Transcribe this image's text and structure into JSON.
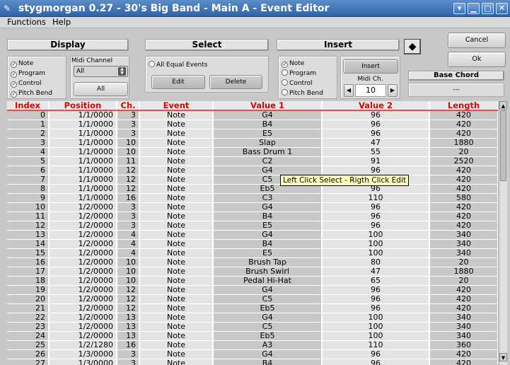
{
  "window": {
    "title": "stygmorgan 0.27 - 30's Big Band - Main A - Event Editor",
    "controls": [
      "▾",
      "▁",
      "□",
      "✕"
    ]
  },
  "menu": [
    "Functions",
    "Help"
  ],
  "display": {
    "header": "Display",
    "options": [
      "Note",
      "Program",
      "Control",
      "Pitch Bend"
    ],
    "midi_channel_label": "Midi Channel",
    "midi_channel_value": "All",
    "all_button": "All"
  },
  "select": {
    "header": "Select",
    "all_equal_events": "All Equal Events",
    "edit_button": "Edit",
    "delete_button": "Delete"
  },
  "insert": {
    "header": "Insert",
    "options": [
      "Note",
      "Program",
      "Control",
      "Pitch Bend"
    ],
    "insert_button": "Insert",
    "midi_ch_label": "Midi Ch.",
    "midi_ch_value": "10"
  },
  "side": {
    "cancel_button": "Cancel",
    "ok_button": "Ok",
    "base_chord_label": "Base Chord",
    "base_chord_value": "---"
  },
  "table": {
    "columns": [
      "Index",
      "Position",
      "Ch.",
      "Event",
      "Value 1",
      "Value 2",
      "Length"
    ],
    "rows": [
      [
        "0",
        "1/1/0000",
        "3",
        "Note",
        "G4",
        "96",
        "420"
      ],
      [
        "1",
        "1/1/0000",
        "3",
        "Note",
        "B4",
        "96",
        "420"
      ],
      [
        "2",
        "1/1/0000",
        "3",
        "Note",
        "E5",
        "96",
        "420"
      ],
      [
        "3",
        "1/1/0000",
        "10",
        "Note",
        "Slap",
        "47",
        "1880"
      ],
      [
        "4",
        "1/1/0000",
        "10",
        "Note",
        "Bass Drum 1",
        "55",
        "20"
      ],
      [
        "5",
        "1/1/0000",
        "11",
        "Note",
        "C2",
        "91",
        "2520"
      ],
      [
        "6",
        "1/1/0000",
        "12",
        "Note",
        "G4",
        "96",
        "420"
      ],
      [
        "7",
        "1/1/0000",
        "12",
        "Note",
        "C5",
        "",
        "420"
      ],
      [
        "8",
        "1/1/0000",
        "12",
        "Note",
        "Eb5",
        "96",
        "420"
      ],
      [
        "9",
        "1/1/0000",
        "16",
        "Note",
        "C3",
        "110",
        "580"
      ],
      [
        "10",
        "1/2/0000",
        "3",
        "Note",
        "G4",
        "96",
        "420"
      ],
      [
        "11",
        "1/2/0000",
        "3",
        "Note",
        "B4",
        "96",
        "420"
      ],
      [
        "12",
        "1/2/0000",
        "3",
        "Note",
        "E5",
        "96",
        "420"
      ],
      [
        "13",
        "1/2/0000",
        "4",
        "Note",
        "G4",
        "100",
        "340"
      ],
      [
        "14",
        "1/2/0000",
        "4",
        "Note",
        "B4",
        "100",
        "340"
      ],
      [
        "15",
        "1/2/0000",
        "4",
        "Note",
        "E5",
        "100",
        "340"
      ],
      [
        "16",
        "1/2/0000",
        "10",
        "Note",
        "Brush Tap",
        "80",
        "20"
      ],
      [
        "17",
        "1/2/0000",
        "10",
        "Note",
        "Brush Swirl",
        "47",
        "1880"
      ],
      [
        "18",
        "1/2/0000",
        "10",
        "Note",
        "Pedal Hi-Hat",
        "65",
        "20"
      ],
      [
        "19",
        "1/2/0000",
        "12",
        "Note",
        "G4",
        "96",
        "420"
      ],
      [
        "20",
        "1/2/0000",
        "12",
        "Note",
        "C5",
        "96",
        "420"
      ],
      [
        "21",
        "1/2/0000",
        "12",
        "Note",
        "Eb5",
        "96",
        "420"
      ],
      [
        "22",
        "1/2/0000",
        "13",
        "Note",
        "G4",
        "100",
        "340"
      ],
      [
        "23",
        "1/2/0000",
        "13",
        "Note",
        "C5",
        "100",
        "340"
      ],
      [
        "24",
        "1/2/0000",
        "13",
        "Note",
        "Eb5",
        "100",
        "340"
      ],
      [
        "25",
        "1/2/1280",
        "16",
        "Note",
        "A3",
        "110",
        "360"
      ],
      [
        "26",
        "1/3/0000",
        "3",
        "Note",
        "G4",
        "96",
        "420"
      ],
      [
        "27",
        "1/3/0000",
        "3",
        "Note",
        "B4",
        "96",
        "420"
      ]
    ]
  },
  "tooltip": "Left Click Select - Rigth Click Edit"
}
